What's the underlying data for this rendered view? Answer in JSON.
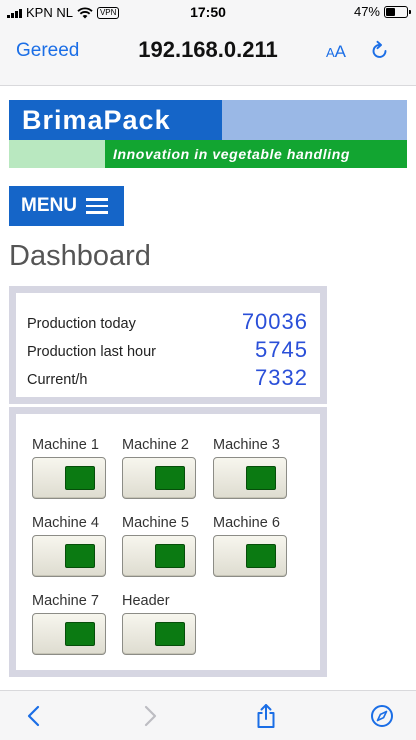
{
  "status_bar": {
    "carrier": "KPN NL",
    "vpn_label": "VPN",
    "time": "17:50",
    "battery_percent": "47%",
    "battery_level": 0.47
  },
  "browser": {
    "done_label": "Gereed",
    "address": "192.168.0.211",
    "aa_small": "A",
    "aa_large": "A"
  },
  "logo": {
    "name": "BrimaPack",
    "tagline": "Innovation in vegetable handling"
  },
  "menu": {
    "label": "MENU"
  },
  "page": {
    "title": "Dashboard"
  },
  "stats": [
    {
      "label": "Production today",
      "value": "70036"
    },
    {
      "label": "Production last hour",
      "value": "5745"
    },
    {
      "label": "Current/h",
      "value": "7332"
    }
  ],
  "machines": [
    {
      "label": "Machine 1",
      "on": true
    },
    {
      "label": "Machine 2",
      "on": true
    },
    {
      "label": "Machine 3",
      "on": true
    },
    {
      "label": "Machine 4",
      "on": true
    },
    {
      "label": "Machine 5",
      "on": true
    },
    {
      "label": "Machine 6",
      "on": true
    },
    {
      "label": "Machine 7",
      "on": true
    },
    {
      "label": "Header",
      "on": true
    }
  ],
  "colors": {
    "brand_blue": "#1565c8",
    "brand_green": "#12a531",
    "link_blue": "#1b6ee6",
    "value_blue": "#2a4fd8",
    "switch_on": "#0b7a12"
  },
  "toolbar_icons": [
    "back-icon",
    "forward-icon",
    "share-icon",
    "compass-icon"
  ]
}
